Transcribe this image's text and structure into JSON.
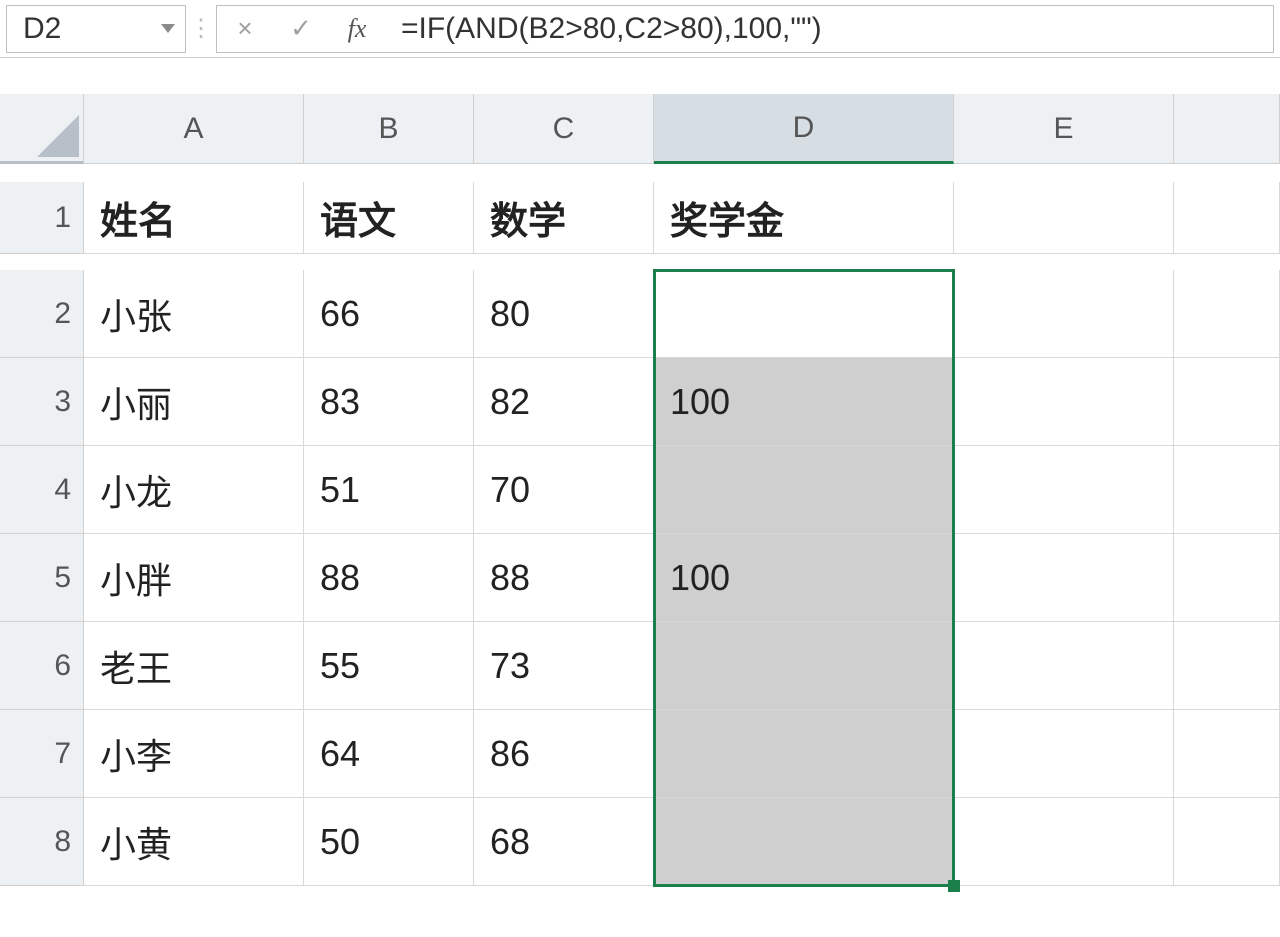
{
  "nameBox": "D2",
  "formula": "=IF(AND(B2>80,C2>80),100,\"\")",
  "columns": [
    "A",
    "B",
    "C",
    "D",
    "E"
  ],
  "rows": [
    "1",
    "2",
    "3",
    "4",
    "5",
    "6",
    "7",
    "8"
  ],
  "headers": {
    "A": "姓名",
    "B": "语文",
    "C": "数学",
    "D": "奖学金"
  },
  "data": [
    {
      "name": "小张",
      "chinese": "66",
      "math": "80",
      "award": ""
    },
    {
      "name": "小丽",
      "chinese": "83",
      "math": "82",
      "award": "100"
    },
    {
      "name": "小龙",
      "chinese": "51",
      "math": "70",
      "award": ""
    },
    {
      "name": "小胖",
      "chinese": "88",
      "math": "88",
      "award": "100"
    },
    {
      "name": "老王",
      "chinese": "55",
      "math": "73",
      "award": ""
    },
    {
      "name": "小李",
      "chinese": "64",
      "math": "86",
      "award": ""
    },
    {
      "name": "小黄",
      "chinese": "50",
      "math": "68",
      "award": ""
    }
  ],
  "icons": {
    "cancel": "×",
    "enter": "✓",
    "fx": "fx"
  }
}
